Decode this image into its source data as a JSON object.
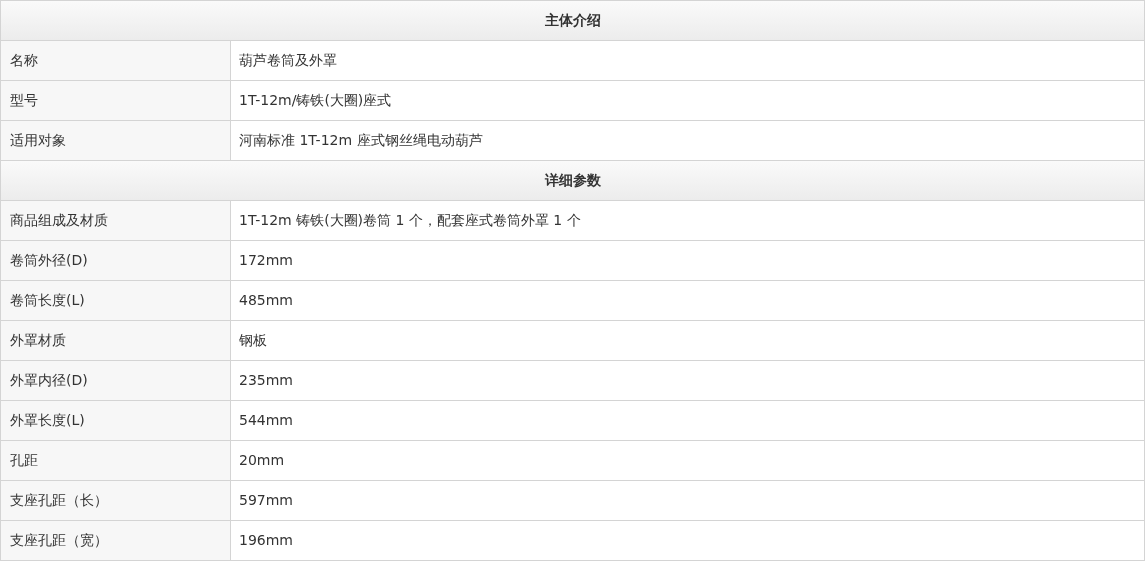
{
  "sections": [
    {
      "title": "主体介绍",
      "rows": [
        {
          "label": "名称",
          "value": "葫芦卷筒及外罩"
        },
        {
          "label": "型号",
          "value": "1T-12m/铸铁(大圈)座式"
        },
        {
          "label": "适用对象",
          "value": "河南标准 1T-12m 座式钢丝绳电动葫芦"
        }
      ]
    },
    {
      "title": "详细参数",
      "rows": [
        {
          "label": "商品组成及材质",
          "value": "1T-12m 铸铁(大圈)卷筒 1 个，配套座式卷筒外罩 1 个"
        },
        {
          "label": "卷筒外径(D)",
          "value": "172mm"
        },
        {
          "label": "卷筒长度(L)",
          "value": "485mm"
        },
        {
          "label": "外罩材质",
          "value": "钢板"
        },
        {
          "label": "外罩内径(D)",
          "value": "235mm"
        },
        {
          "label": "外罩长度(L)",
          "value": "544mm"
        },
        {
          "label": "孔距",
          "value": "20mm"
        },
        {
          "label": "支座孔距（长）",
          "value": "597mm"
        },
        {
          "label": "支座孔距（宽）",
          "value": "196mm"
        }
      ]
    }
  ]
}
